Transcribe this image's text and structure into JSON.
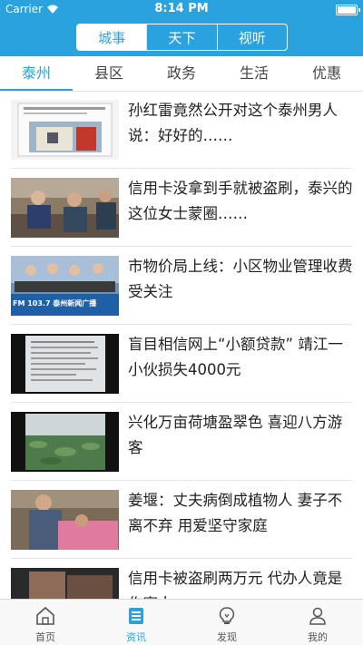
{
  "status_bar": {
    "carrier": "Carrier",
    "time": "8:14 PM"
  },
  "segments": [
    {
      "label": "城事",
      "active": true
    },
    {
      "label": "天下",
      "active": false
    },
    {
      "label": "视听",
      "active": false
    }
  ],
  "categories": [
    {
      "label": "泰州",
      "active": true
    },
    {
      "label": "县区",
      "active": false
    },
    {
      "label": "政务",
      "active": false
    },
    {
      "label": "生活",
      "active": false
    },
    {
      "label": "优惠",
      "active": false
    }
  ],
  "news": [
    {
      "title": "孙红雷竟然公开对这个泰州男人说：好好的……"
    },
    {
      "title": "信用卡没拿到手就被盗刷，泰兴的这位女士蒙圈……"
    },
    {
      "title": "市物价局上线：小区物业管理收费受关注"
    },
    {
      "title": "盲目相信网上“小额贷款” 靖江一小伙损失4000元"
    },
    {
      "title": "兴化万亩荷塘盈翠色 喜迎八方游客"
    },
    {
      "title": "姜堰：丈夫病倒成植物人 妻子不离不弃 用爱坚守家庭"
    },
    {
      "title": "信用卡被盗刷两万元 代办人竟是作案人"
    }
  ],
  "thumb_texts": {
    "fm": "FM 103.7 泰州新闻广播"
  },
  "tabbar": [
    {
      "label": "首页",
      "icon": "home-icon",
      "active": false
    },
    {
      "label": "资讯",
      "icon": "news-icon",
      "active": true
    },
    {
      "label": "发现",
      "icon": "bulb-icon",
      "active": false
    },
    {
      "label": "我的",
      "icon": "user-icon",
      "active": false
    }
  ],
  "colors": {
    "accent": "#2aa2de"
  }
}
